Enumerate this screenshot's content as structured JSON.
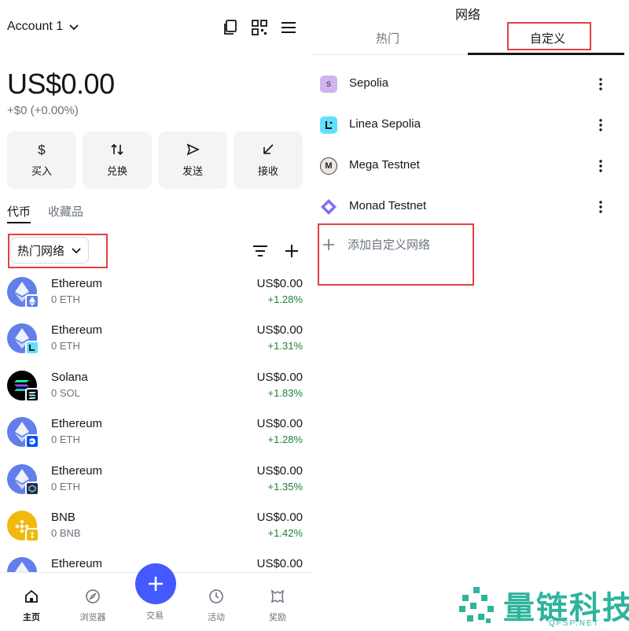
{
  "wallet": {
    "account_name": "Account 1",
    "balance": "US$0.00",
    "change": "+$0 (+0.00%)",
    "actions": [
      {
        "label": "买入",
        "icon": "dollar-icon"
      },
      {
        "label": "兑换",
        "icon": "swap-icon"
      },
      {
        "label": "发送",
        "icon": "send-icon"
      },
      {
        "label": "接收",
        "icon": "receive-icon"
      }
    ],
    "tabs": [
      "代币",
      "收藏品"
    ],
    "network_filter": "热门网络",
    "tokens": [
      {
        "name": "Ethereum",
        "qty": "0 ETH",
        "value": "US$0.00",
        "change": "+1.28%",
        "logo": "ethereum-icon",
        "badge": "ethereum-badge-icon"
      },
      {
        "name": "Ethereum",
        "qty": "0 ETH",
        "value": "US$0.00",
        "change": "+1.31%",
        "logo": "ethereum-icon",
        "badge": "linea-badge-icon"
      },
      {
        "name": "Solana",
        "qty": "0 SOL",
        "value": "US$0.00",
        "change": "+1.83%",
        "logo": "solana-icon",
        "badge": "solana-badge-icon"
      },
      {
        "name": "Ethereum",
        "qty": "0 ETH",
        "value": "US$0.00",
        "change": "+1.28%",
        "logo": "ethereum-icon",
        "badge": "base-badge-icon"
      },
      {
        "name": "Ethereum",
        "qty": "0 ETH",
        "value": "US$0.00",
        "change": "+1.35%",
        "logo": "ethereum-icon",
        "badge": "arbitrum-badge-icon"
      },
      {
        "name": "BNB",
        "qty": "0 BNB",
        "value": "US$0.00",
        "change": "+1.42%",
        "logo": "bnb-icon",
        "badge": "bnb-badge-icon"
      },
      {
        "name": "Ethereum",
        "qty": "",
        "value": "US$0.00",
        "change": "",
        "logo": "ethereum-icon",
        "badge": ""
      }
    ],
    "nav": [
      {
        "label": "主页",
        "icon": "home-icon"
      },
      {
        "label": "浏览器",
        "icon": "compass-icon"
      },
      {
        "label": "交易",
        "icon": "plus-icon"
      },
      {
        "label": "活动",
        "icon": "clock-icon"
      },
      {
        "label": "奖励",
        "icon": "rewards-icon"
      }
    ],
    "colors": {
      "accent": "#4459ff",
      "positive": "#1c8234",
      "highlight": "#e0423f"
    }
  },
  "networks": {
    "title": "网络",
    "tabs": [
      "热门",
      "自定义"
    ],
    "list": [
      {
        "name": "Sepolia",
        "icon": "sepolia-icon",
        "icon_text": "S"
      },
      {
        "name": "Linea Sepolia",
        "icon": "linea-icon",
        "icon_text": ""
      },
      {
        "name": "Mega Testnet",
        "icon": "mega-icon",
        "icon_text": "M"
      },
      {
        "name": "Monad Testnet",
        "icon": "monad-icon",
        "icon_text": ""
      }
    ],
    "add_custom": "添加自定义网络"
  },
  "watermark": {
    "text": "量链科技",
    "sub": "QFSP.NET"
  }
}
